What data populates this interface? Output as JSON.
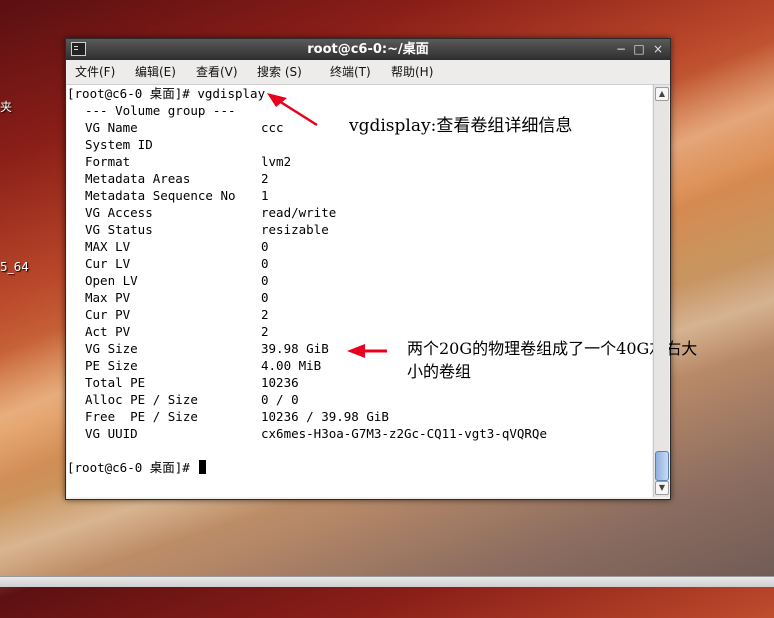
{
  "desktop": {
    "labels": [
      "夹",
      "5_64"
    ]
  },
  "window": {
    "title": "root@c6-0:~/桌面",
    "controls": {
      "minimize": "−",
      "maximize": "□",
      "close": "×"
    }
  },
  "menubar": {
    "items": [
      "文件(F)",
      "编辑(E)",
      "查看(V)",
      "搜索 (S)",
      "终端(T)",
      "帮助(H)"
    ]
  },
  "terminal": {
    "command_line": "[root@c6-0 桌面]# vgdisplay",
    "section_header": "--- Volume group ---",
    "rows": [
      {
        "key": "VG Name",
        "value": "ccc"
      },
      {
        "key": "System ID",
        "value": ""
      },
      {
        "key": "Format",
        "value": "lvm2"
      },
      {
        "key": "Metadata Areas",
        "value": "2"
      },
      {
        "key": "Metadata Sequence No",
        "value": "1"
      },
      {
        "key": "VG Access",
        "value": "read/write"
      },
      {
        "key": "VG Status",
        "value": "resizable"
      },
      {
        "key": "MAX LV",
        "value": "0"
      },
      {
        "key": "Cur LV",
        "value": "0"
      },
      {
        "key": "Open LV",
        "value": "0"
      },
      {
        "key": "Max PV",
        "value": "0"
      },
      {
        "key": "Cur PV",
        "value": "2"
      },
      {
        "key": "Act PV",
        "value": "2"
      },
      {
        "key": "VG Size",
        "value": "39.98 GiB"
      },
      {
        "key": "PE Size",
        "value": "4.00 MiB"
      },
      {
        "key": "Total PE",
        "value": "10236"
      },
      {
        "key": "Alloc PE / Size",
        "value": "0 / 0"
      },
      {
        "key": "Free  PE / Size",
        "value": "10236 / 39.98 GiB"
      },
      {
        "key": "VG UUID",
        "value": "cx6mes-H3oa-G7M3-z2Gc-CQ11-vgt3-qVQRQe"
      }
    ],
    "prompt": "[root@c6-0 桌面]# "
  },
  "annotations": {
    "vgdisplay_note": "vgdisplay:查看卷组详细信息",
    "size_note_line1": "两个20G的物理卷组成了一个40G左右大",
    "size_note_line2": "小的卷组",
    "arrow_color": "#e8001c"
  },
  "colors": {
    "terminal_bg": "#ffffff",
    "titlebar": "#3a3a3a",
    "scroll_thumb": "#9bb8e3"
  }
}
